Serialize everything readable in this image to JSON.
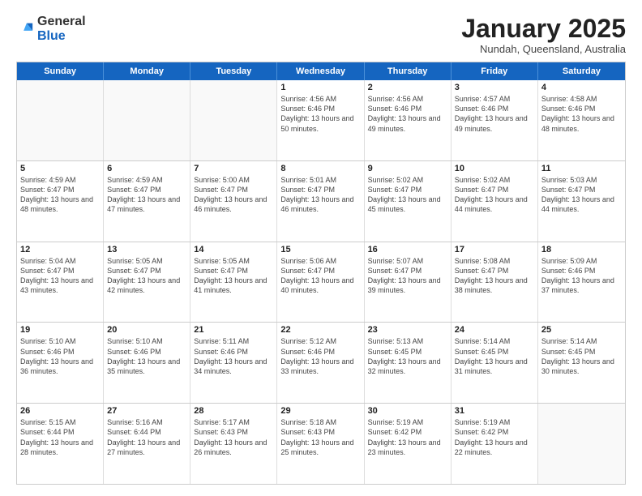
{
  "app": {
    "logo_line1": "General",
    "logo_line2": "Blue"
  },
  "header": {
    "title": "January 2025",
    "subtitle": "Nundah, Queensland, Australia"
  },
  "weekdays": [
    "Sunday",
    "Monday",
    "Tuesday",
    "Wednesday",
    "Thursday",
    "Friday",
    "Saturday"
  ],
  "weeks": [
    [
      {
        "day": "",
        "empty": true
      },
      {
        "day": "",
        "empty": true
      },
      {
        "day": "",
        "empty": true
      },
      {
        "day": "1",
        "sunrise": "4:56 AM",
        "sunset": "6:46 PM",
        "daylight": "13 hours and 50 minutes."
      },
      {
        "day": "2",
        "sunrise": "4:56 AM",
        "sunset": "6:46 PM",
        "daylight": "13 hours and 49 minutes."
      },
      {
        "day": "3",
        "sunrise": "4:57 AM",
        "sunset": "6:46 PM",
        "daylight": "13 hours and 49 minutes."
      },
      {
        "day": "4",
        "sunrise": "4:58 AM",
        "sunset": "6:46 PM",
        "daylight": "13 hours and 48 minutes."
      }
    ],
    [
      {
        "day": "5",
        "sunrise": "4:59 AM",
        "sunset": "6:47 PM",
        "daylight": "13 hours and 48 minutes."
      },
      {
        "day": "6",
        "sunrise": "4:59 AM",
        "sunset": "6:47 PM",
        "daylight": "13 hours and 47 minutes."
      },
      {
        "day": "7",
        "sunrise": "5:00 AM",
        "sunset": "6:47 PM",
        "daylight": "13 hours and 46 minutes."
      },
      {
        "day": "8",
        "sunrise": "5:01 AM",
        "sunset": "6:47 PM",
        "daylight": "13 hours and 46 minutes."
      },
      {
        "day": "9",
        "sunrise": "5:02 AM",
        "sunset": "6:47 PM",
        "daylight": "13 hours and 45 minutes."
      },
      {
        "day": "10",
        "sunrise": "5:02 AM",
        "sunset": "6:47 PM",
        "daylight": "13 hours and 44 minutes."
      },
      {
        "day": "11",
        "sunrise": "5:03 AM",
        "sunset": "6:47 PM",
        "daylight": "13 hours and 44 minutes."
      }
    ],
    [
      {
        "day": "12",
        "sunrise": "5:04 AM",
        "sunset": "6:47 PM",
        "daylight": "13 hours and 43 minutes."
      },
      {
        "day": "13",
        "sunrise": "5:05 AM",
        "sunset": "6:47 PM",
        "daylight": "13 hours and 42 minutes."
      },
      {
        "day": "14",
        "sunrise": "5:05 AM",
        "sunset": "6:47 PM",
        "daylight": "13 hours and 41 minutes."
      },
      {
        "day": "15",
        "sunrise": "5:06 AM",
        "sunset": "6:47 PM",
        "daylight": "13 hours and 40 minutes."
      },
      {
        "day": "16",
        "sunrise": "5:07 AM",
        "sunset": "6:47 PM",
        "daylight": "13 hours and 39 minutes."
      },
      {
        "day": "17",
        "sunrise": "5:08 AM",
        "sunset": "6:47 PM",
        "daylight": "13 hours and 38 minutes."
      },
      {
        "day": "18",
        "sunrise": "5:09 AM",
        "sunset": "6:46 PM",
        "daylight": "13 hours and 37 minutes."
      }
    ],
    [
      {
        "day": "19",
        "sunrise": "5:10 AM",
        "sunset": "6:46 PM",
        "daylight": "13 hours and 36 minutes."
      },
      {
        "day": "20",
        "sunrise": "5:10 AM",
        "sunset": "6:46 PM",
        "daylight": "13 hours and 35 minutes."
      },
      {
        "day": "21",
        "sunrise": "5:11 AM",
        "sunset": "6:46 PM",
        "daylight": "13 hours and 34 minutes."
      },
      {
        "day": "22",
        "sunrise": "5:12 AM",
        "sunset": "6:46 PM",
        "daylight": "13 hours and 33 minutes."
      },
      {
        "day": "23",
        "sunrise": "5:13 AM",
        "sunset": "6:45 PM",
        "daylight": "13 hours and 32 minutes."
      },
      {
        "day": "24",
        "sunrise": "5:14 AM",
        "sunset": "6:45 PM",
        "daylight": "13 hours and 31 minutes."
      },
      {
        "day": "25",
        "sunrise": "5:14 AM",
        "sunset": "6:45 PM",
        "daylight": "13 hours and 30 minutes."
      }
    ],
    [
      {
        "day": "26",
        "sunrise": "5:15 AM",
        "sunset": "6:44 PM",
        "daylight": "13 hours and 28 minutes."
      },
      {
        "day": "27",
        "sunrise": "5:16 AM",
        "sunset": "6:44 PM",
        "daylight": "13 hours and 27 minutes."
      },
      {
        "day": "28",
        "sunrise": "5:17 AM",
        "sunset": "6:43 PM",
        "daylight": "13 hours and 26 minutes."
      },
      {
        "day": "29",
        "sunrise": "5:18 AM",
        "sunset": "6:43 PM",
        "daylight": "13 hours and 25 minutes."
      },
      {
        "day": "30",
        "sunrise": "5:19 AM",
        "sunset": "6:42 PM",
        "daylight": "13 hours and 23 minutes."
      },
      {
        "day": "31",
        "sunrise": "5:19 AM",
        "sunset": "6:42 PM",
        "daylight": "13 hours and 22 minutes."
      },
      {
        "day": "",
        "empty": true
      }
    ]
  ]
}
